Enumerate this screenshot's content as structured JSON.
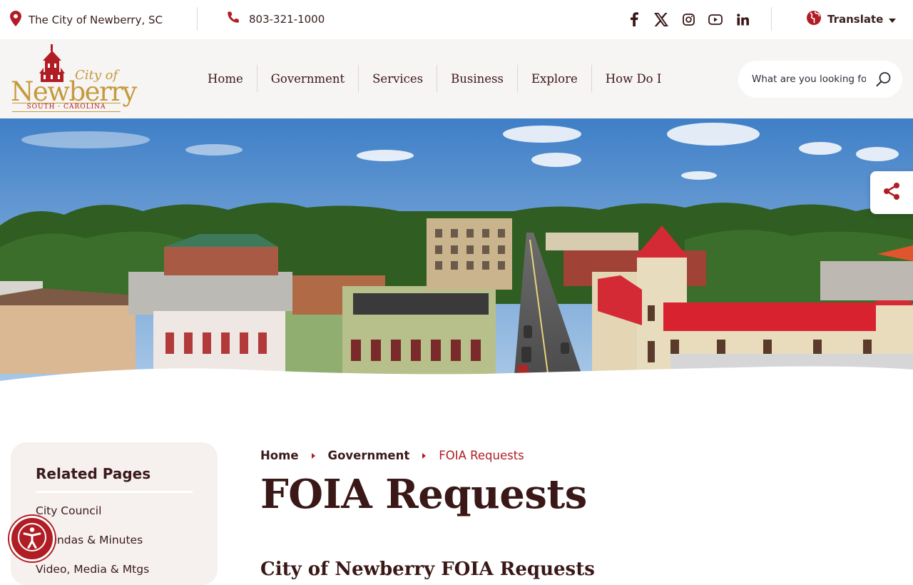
{
  "utility": {
    "location": "The City of Newberry, SC",
    "phone": "803-321-1000",
    "socials": [
      "facebook-icon",
      "x-icon",
      "instagram-icon",
      "youtube-icon",
      "linkedin-icon"
    ],
    "translate_label": "Translate"
  },
  "logo": {
    "city_of": "City of",
    "name": "Newberry",
    "state": "SOUTH · CAROLINA"
  },
  "nav": {
    "items": [
      "Home",
      "Government",
      "Services",
      "Business",
      "Explore",
      "How Do I"
    ]
  },
  "search": {
    "placeholder": "What are you looking for?"
  },
  "sidebar": {
    "title": "Related Pages",
    "links": [
      "City Council",
      "Agendas & Minutes",
      "Video, Media & Mtgs"
    ]
  },
  "breadcrumb": {
    "items": [
      "Home",
      "Government"
    ],
    "current": "FOIA Requests"
  },
  "page": {
    "title": "FOIA Requests",
    "subheading": "City of Newberry FOIA Requests"
  },
  "colors": {
    "brand_red": "#b01d24",
    "text_dark": "#3a1818",
    "logo_gold": "#c49a3c",
    "header_bg": "#f7f4f4",
    "sidebar_bg": "#f6f0ef"
  }
}
